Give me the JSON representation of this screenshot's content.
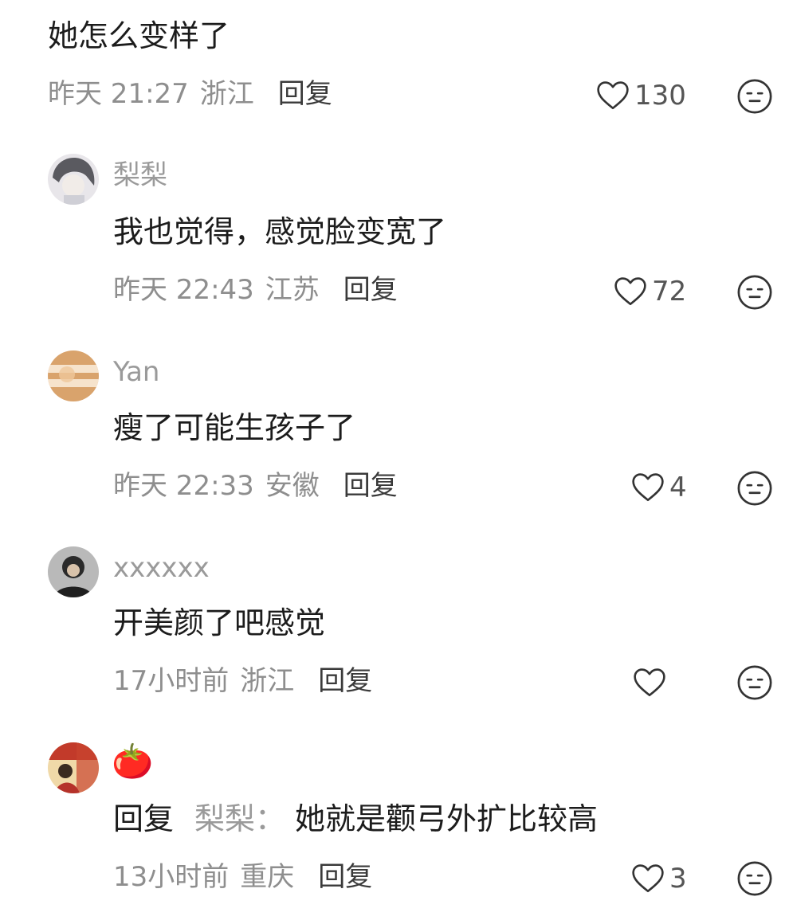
{
  "top": {
    "text": "她怎么变样了",
    "time": "昨天 21:27",
    "location": "浙江",
    "reply": "回复",
    "likes": "130"
  },
  "comments": [
    {
      "name": "梨梨",
      "text": "我也觉得，感觉脸变宽了",
      "time": "昨天 22:43",
      "location": "江苏",
      "reply": "回复",
      "likes": "72"
    },
    {
      "name": "Yan",
      "text": "瘦了可能生孩子了",
      "time": "昨天 22:33",
      "location": "安徽",
      "reply": "回复",
      "likes": "4"
    },
    {
      "name": "xxxxxx",
      "text": "开美颜了吧感觉",
      "time": "17小时前",
      "location": "浙江",
      "reply": "回复",
      "likes": ""
    },
    {
      "name": "🍅",
      "reply_prefix": "回复",
      "reply_target": "梨梨：",
      "text": "她就是颧弓外扩比较高",
      "time": "13小时前",
      "location": "重庆",
      "reply": "回复",
      "likes": "3"
    }
  ],
  "colors": {
    "meta": "#8e8e8e",
    "text": "#1c1c1c",
    "icon": "#333333"
  },
  "icons": {
    "like": "heart-outline-icon",
    "emoji": "neutral-face-icon"
  }
}
